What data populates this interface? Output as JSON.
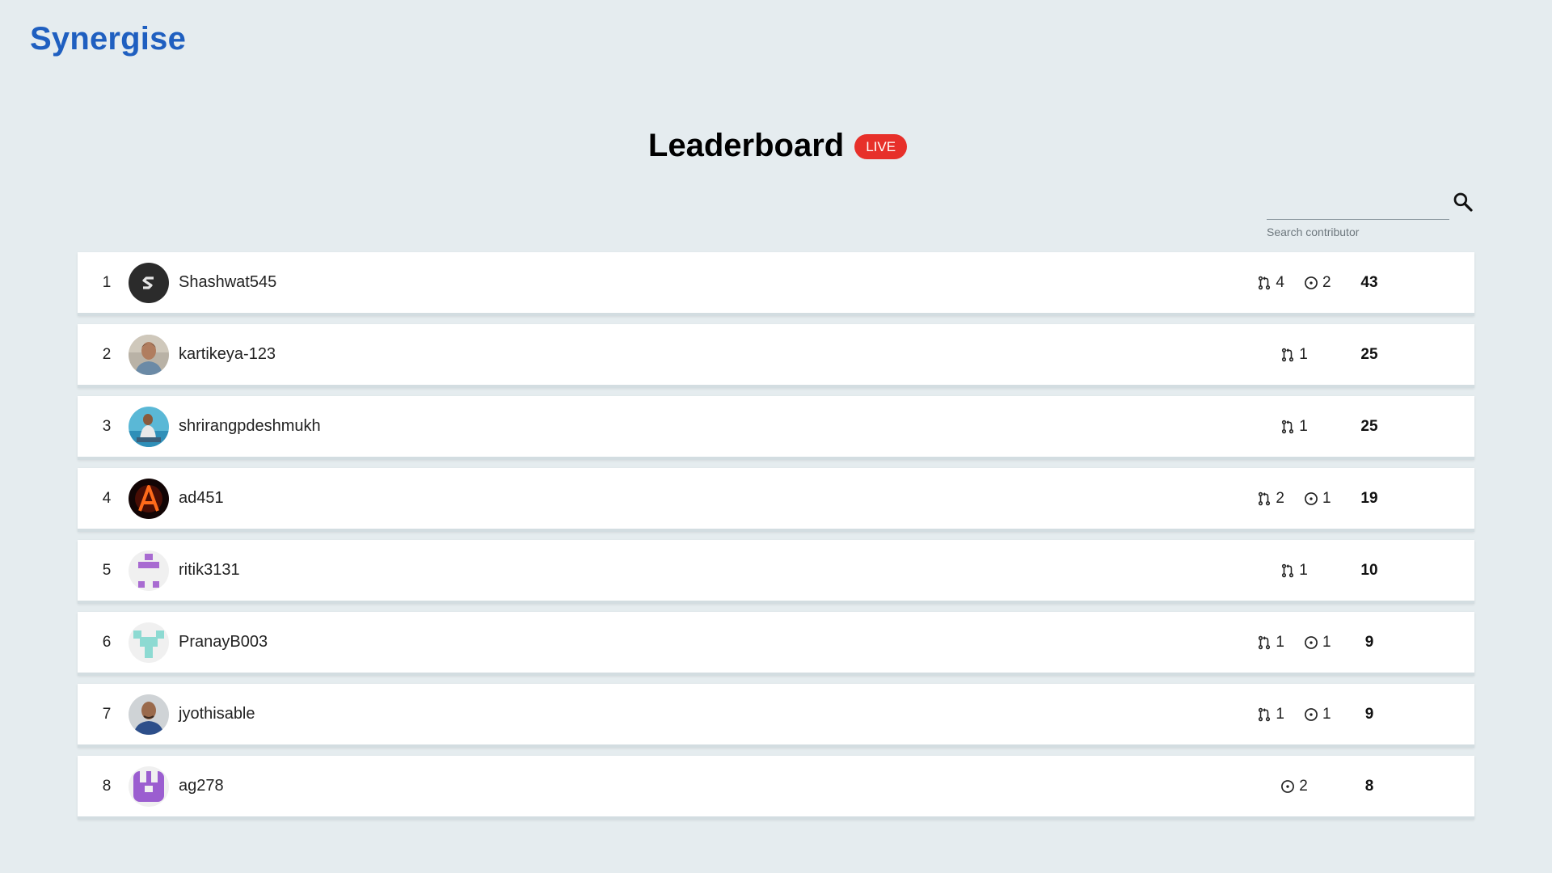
{
  "brand": {
    "name": "Synergise",
    "color": "#1f5fc0"
  },
  "header": {
    "title": "Leaderboard",
    "live_label": "LIVE",
    "live_color": "#e7302a"
  },
  "search": {
    "value": "",
    "label": "Search contributor",
    "icon": "search-icon"
  },
  "icons": {
    "pull_request": "git-pull-request-icon",
    "issue": "issue-circle-icon"
  },
  "rows": [
    {
      "rank": "1",
      "username": "Shashwat545",
      "prs": "4",
      "issues": "2",
      "score": "43"
    },
    {
      "rank": "2",
      "username": "kartikeya-123",
      "prs": "1",
      "issues": null,
      "score": "25"
    },
    {
      "rank": "3",
      "username": "shrirangpdeshmukh",
      "prs": "1",
      "issues": null,
      "score": "25"
    },
    {
      "rank": "4",
      "username": "ad451",
      "prs": "2",
      "issues": "1",
      "score": "19"
    },
    {
      "rank": "5",
      "username": "ritik3131",
      "prs": "1",
      "issues": null,
      "score": "10"
    },
    {
      "rank": "6",
      "username": "PranayB003",
      "prs": "1",
      "issues": "1",
      "score": "9"
    },
    {
      "rank": "7",
      "username": "jyothisable",
      "prs": "1",
      "issues": "1",
      "score": "9"
    },
    {
      "rank": "8",
      "username": "ag278",
      "prs": null,
      "issues": "2",
      "score": "8"
    }
  ]
}
